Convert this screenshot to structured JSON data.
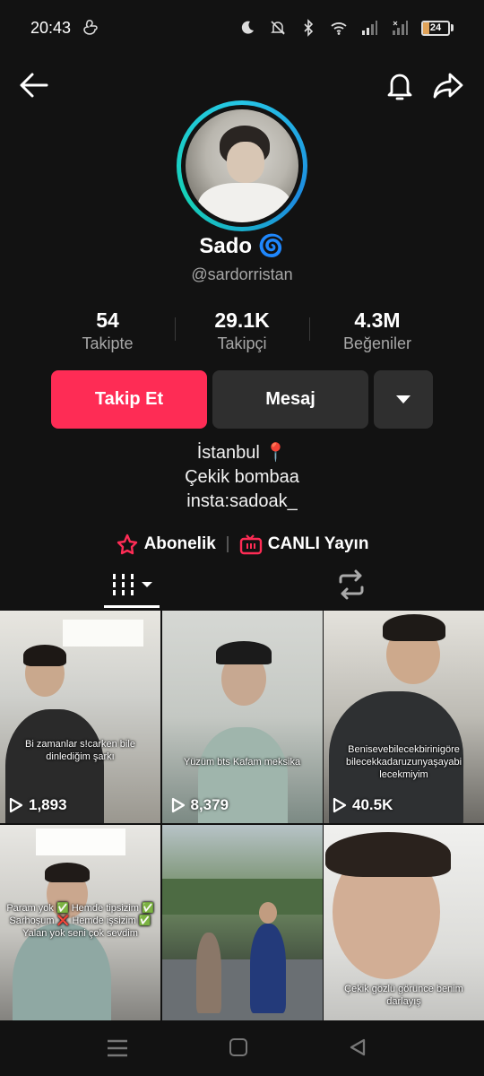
{
  "status_bar": {
    "time": "20:43",
    "battery_level": "24",
    "battery_fraction": 0.24
  },
  "profile": {
    "name": "Sado 🌀",
    "handle": "@sardorristan",
    "stats": [
      {
        "value": "54",
        "label": "Takipte"
      },
      {
        "value": "29.1K",
        "label": "Takipçi"
      },
      {
        "value": "4.3M",
        "label": "Beğeniler"
      }
    ],
    "buttons": {
      "follow": "Takip Et",
      "message": "Mesaj"
    },
    "bio": [
      "İstanbul 📍",
      "Çekik bombaa",
      "insta:sadoak_"
    ],
    "links": {
      "subscription": "Abonelik",
      "live": "CANLI Yayın"
    }
  },
  "videos": [
    {
      "views": "1,893",
      "caption": "Bi zamanlar s!carken bile dinlediğim şarkı"
    },
    {
      "views": "8,379",
      "caption": "Yüzüm bts Kafam meksika"
    },
    {
      "views": "40.5K",
      "caption": "Benisevebilecekbirinigöre bilecekkadaruzunyaşayabi lecekmiyim"
    },
    {
      "views": "",
      "caption": "Param yok ✅ Hemde tipsizim ✅ Sarhoşum ❌ Hemde işsizim ✅ Yalan yok seni çok sevdim"
    },
    {
      "views": "",
      "caption": ""
    },
    {
      "views": "",
      "caption": "Çekik gözlü görünce benim darlayış"
    }
  ],
  "colors": {
    "follow": "#fe2c55",
    "secondary_button": "#2f2f2f",
    "background": "#121212",
    "ring": "#26c6e6"
  }
}
